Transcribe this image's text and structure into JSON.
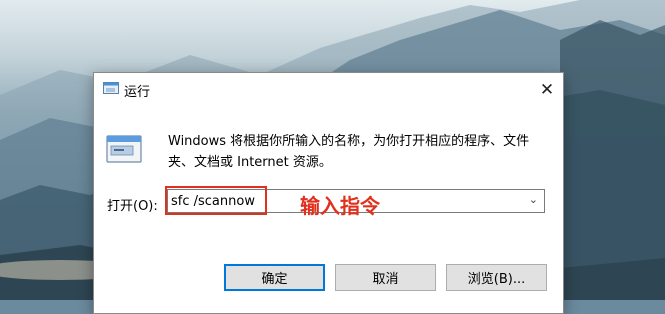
{
  "dialog": {
    "title": "运行",
    "close_glyph": "✕",
    "title_icon": "run-icon",
    "description": "Windows 将根据你所输入的名称，为你打开相应的程序、文件夹、文档或 Internet 资源。",
    "open_label": "打开(O):",
    "input_value": "sfc /scannow",
    "dropdown_glyph": "⌄",
    "annotation": "输入指令",
    "buttons": {
      "ok": "确定",
      "cancel": "取消",
      "browse": "浏览(B)..."
    }
  },
  "colors": {
    "annotation_red": "#e0301e",
    "focus_blue": "#0078d7"
  }
}
